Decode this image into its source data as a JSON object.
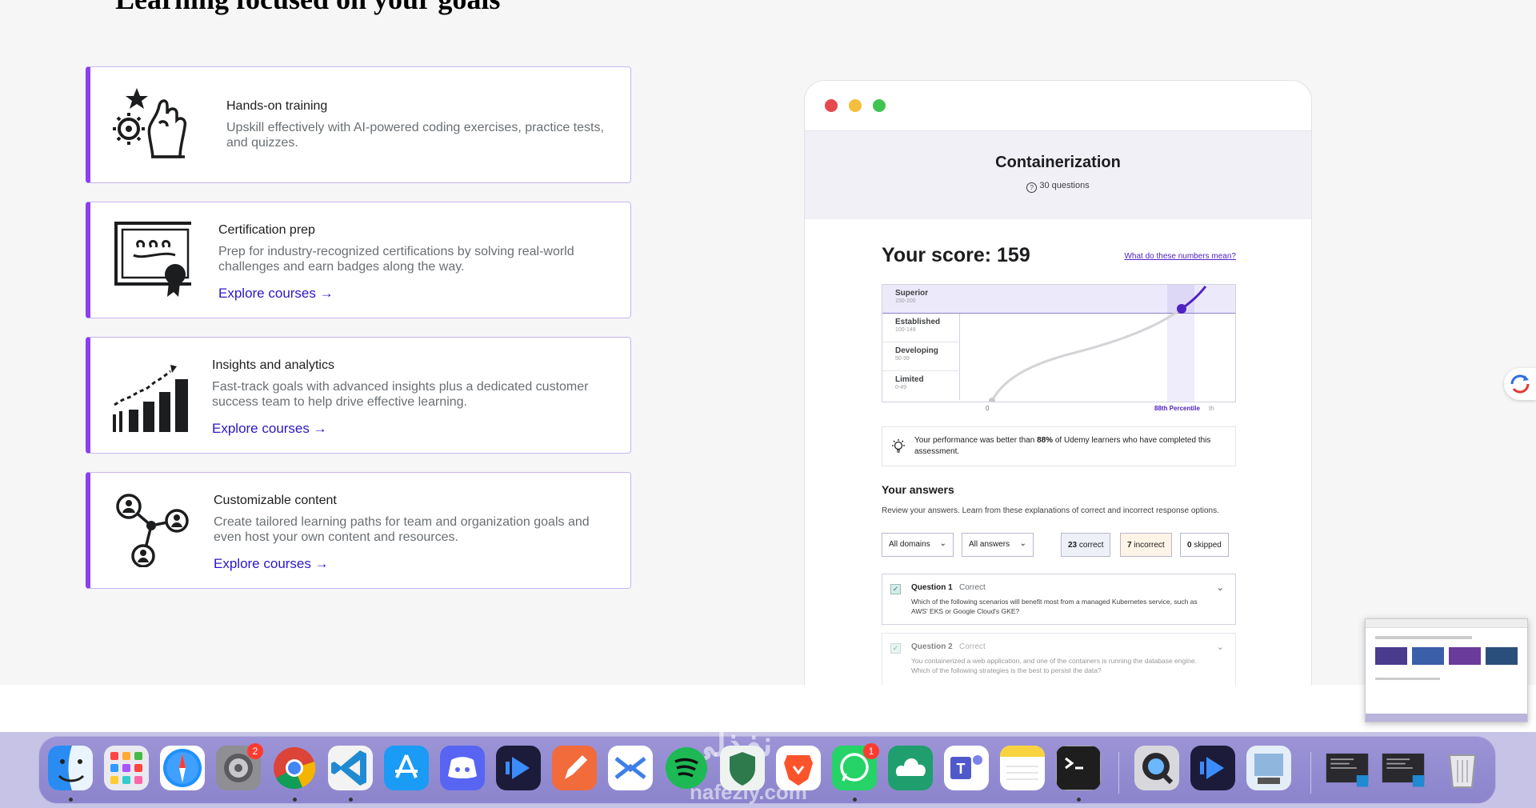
{
  "page": {
    "heading": "Learning focused on your goals"
  },
  "features": [
    {
      "title": "Hands-on training",
      "description": "Upskill effectively with AI-powered coding exercises, practice tests, and quizzes.",
      "link": "",
      "icon": "hand-gear-star-icon"
    },
    {
      "title": "Certification prep",
      "description": "Prep for industry-recognized certifications by solving real-world challenges and earn badges along the way.",
      "link": "Explore courses →",
      "icon": "certificate-icon"
    },
    {
      "title": "Insights and analytics",
      "description": "Fast-track goals with advanced insights plus a dedicated customer success team to help drive effective learning.",
      "link": "Explore courses →",
      "icon": "bar-chart-icon"
    },
    {
      "title": "Customizable content",
      "description": "Create tailored learning paths for team and organization goals and even host your own content and resources.",
      "link": "Explore courses →",
      "icon": "network-nodes-icon"
    }
  ],
  "assessment": {
    "title": "Containerization",
    "question_count": "30 questions",
    "score_label": "Your score: 159",
    "numbers_link": "What do these numbers mean?",
    "bands": [
      {
        "name": "Superior",
        "range": "150-200"
      },
      {
        "name": "Established",
        "range": "100-149"
      },
      {
        "name": "Developing",
        "range": "50-99"
      },
      {
        "name": "Limited",
        "range": "0-49"
      }
    ],
    "axis_start": "0",
    "percentile_label": "88th Percentile",
    "percentile_suffix": "th",
    "performance": {
      "before": "Your performance was better than ",
      "value": "88%",
      "after": " of Udemy learners who have completed this assessment."
    },
    "answers_title": "Your answers",
    "answers_desc": "Review your answers. Learn from these explanations of correct and incorrect response options.",
    "filter_domains": "All domains",
    "filter_answers": "All answers",
    "correct_count": "23",
    "correct_label": "correct",
    "incorrect_count": "7",
    "incorrect_label": "incorrect",
    "skipped_count": "0",
    "skipped_label": "skipped",
    "questions": [
      {
        "label": "Question 1",
        "status": "Correct",
        "text": "Which of the following scenarios will benefit most from a managed Kubernetes service, such as AWS' EKS or Google Cloud's GKE?"
      },
      {
        "label": "Question 2",
        "status": "Correct",
        "text": "You containerized a web application, and one of the containers is running the database engine. Which of the following strategies is the best to persist the data?"
      }
    ],
    "colors": {
      "accent": "#5022c3",
      "card_accent": "#8b3ff0",
      "link": "#2b17c9"
    }
  },
  "dock": {
    "apps": [
      {
        "name": "Finder",
        "icon": "finder-icon"
      },
      {
        "name": "Launchpad",
        "icon": "launchpad-icon"
      },
      {
        "name": "Safari",
        "icon": "safari-icon"
      },
      {
        "name": "System Settings",
        "icon": "settings-icon",
        "badge": "2"
      },
      {
        "name": "Chrome",
        "icon": "chrome-icon"
      },
      {
        "name": "VS Code",
        "icon": "vscode-icon"
      },
      {
        "name": "App Store",
        "icon": "app-store-icon"
      },
      {
        "name": "Discord",
        "icon": "discord-icon"
      },
      {
        "name": "Stream",
        "icon": "stream-icon"
      },
      {
        "name": "Pencil",
        "icon": "pencil-app-icon"
      },
      {
        "name": "Messenger",
        "icon": "messenger-icon"
      },
      {
        "name": "Spotify",
        "icon": "spotify-icon"
      },
      {
        "name": "Shield",
        "icon": "shield-app-icon"
      },
      {
        "name": "Brave",
        "icon": "brave-icon"
      },
      {
        "name": "WhatsApp",
        "icon": "whatsapp-icon",
        "badge": "1"
      },
      {
        "name": "Cloud",
        "icon": "cloud-app-icon"
      },
      {
        "name": "Teams",
        "icon": "teams-icon"
      },
      {
        "name": "Notes",
        "icon": "notes-icon"
      },
      {
        "name": "Terminal",
        "icon": "terminal-icon"
      },
      {
        "name": "QuickTime",
        "icon": "quicktime-icon"
      },
      {
        "name": "Stream 2",
        "icon": "stream-icon"
      },
      {
        "name": "Preview",
        "icon": "preview-icon"
      },
      {
        "name": "Window 1",
        "icon": "window-thumb-icon"
      },
      {
        "name": "Window 2",
        "icon": "window-thumb-icon"
      },
      {
        "name": "Trash",
        "icon": "trash-icon"
      }
    ],
    "watermark_ar": "نفذلي",
    "watermark_en": "nafezly.com"
  }
}
